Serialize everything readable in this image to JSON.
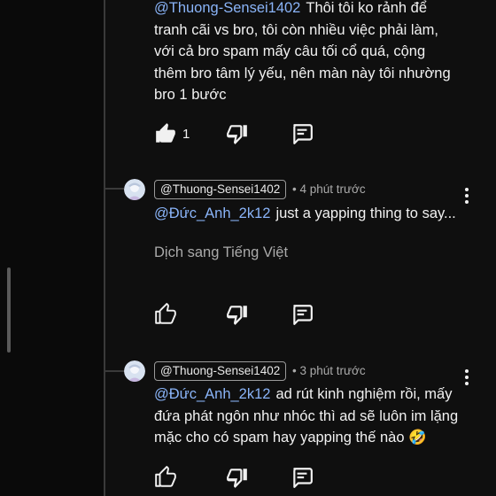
{
  "comments": [
    {
      "mention": "@Thuong-Sensei1402",
      "text": "Thôi tôi ko rảnh để tranh cãi vs bro, tôi còn nhiều việc phải làm, với cả bro spam mấy câu tối cổ quá, cộng thêm bro tâm lý yếu, nên màn này tôi nhường bro 1 bước",
      "like_count": "1"
    },
    {
      "handle": "@Thuong-Sensei1402",
      "time": "• 4 phút trước",
      "mention": "@Đức_Anh_2k12",
      "text": "just a yapping thing to say...",
      "translate": "Dịch sang Tiếng Việt"
    },
    {
      "handle": "@Thuong-Sensei1402",
      "time": "• 3 phút trước",
      "mention": "@Đức_Anh_2k12",
      "text": "ad rút kinh nghiệm rồi, mấy đứa phát ngôn như nhóc thì ad sẽ luôn im lặng mặc cho có spam hay yapping thế nào 🤣"
    }
  ],
  "icons": [
    "like-icon",
    "dislike-icon",
    "reply-icon",
    "more-options-icon",
    "avatar"
  ],
  "colors": {
    "background": "#0f0f0f",
    "mention": "#8ab4f8",
    "secondary_text": "#aaaaaa"
  }
}
